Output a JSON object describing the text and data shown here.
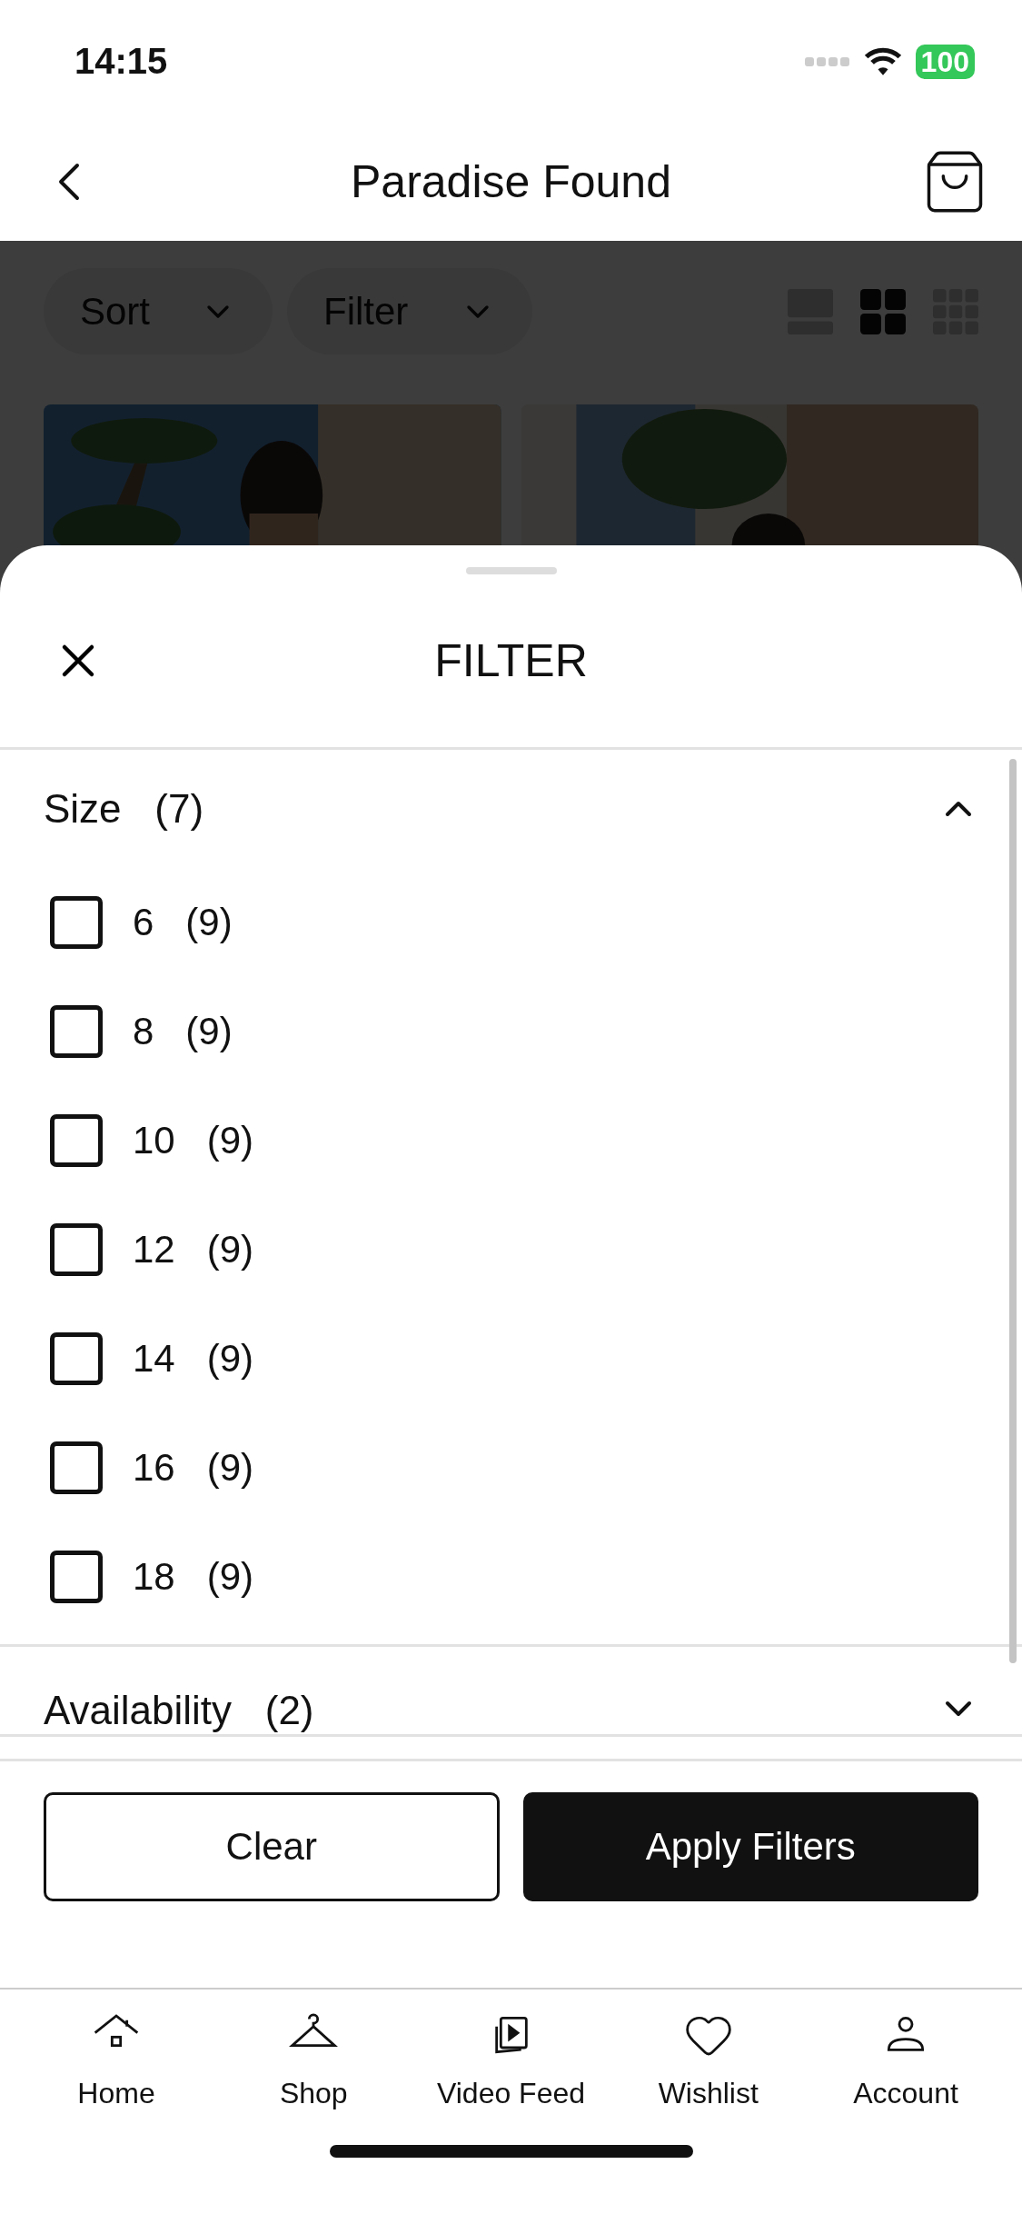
{
  "status_bar": {
    "time": "14:15",
    "battery": "100"
  },
  "nav": {
    "title": "Paradise Found"
  },
  "toolbar": {
    "sort": "Sort",
    "filter": "Filter",
    "views": [
      {
        "kind": "list",
        "selected": false
      },
      {
        "kind": "grid",
        "selected": true
      },
      {
        "kind": "dense",
        "selected": false
      }
    ]
  },
  "filter_sheet": {
    "title": "FILTER",
    "sections": [
      {
        "label": "Size",
        "count": "(7)",
        "expanded": true,
        "options": [
          {
            "label": "6",
            "count": "(9)",
            "checked": false
          },
          {
            "label": "8",
            "count": "(9)",
            "checked": false
          },
          {
            "label": "10",
            "count": "(9)",
            "checked": false
          },
          {
            "label": "12",
            "count": "(9)",
            "checked": false
          },
          {
            "label": "14",
            "count": "(9)",
            "checked": false
          },
          {
            "label": "16",
            "count": "(9)",
            "checked": false
          },
          {
            "label": "18",
            "count": "(9)",
            "checked": false
          }
        ]
      },
      {
        "label": "Availability",
        "count": "(2)",
        "expanded": false
      }
    ],
    "buttons": [
      {
        "kind": "secondary",
        "label": "Clear"
      },
      {
        "kind": "primary",
        "label": "Apply Filters"
      }
    ]
  },
  "tab_bar": [
    {
      "kind": "home",
      "label": "Home"
    },
    {
      "kind": "shop",
      "label": "Shop"
    },
    {
      "kind": "video",
      "label": "Video Feed"
    },
    {
      "kind": "wishlist",
      "label": "Wishlist"
    },
    {
      "kind": "account",
      "label": "Account"
    }
  ]
}
